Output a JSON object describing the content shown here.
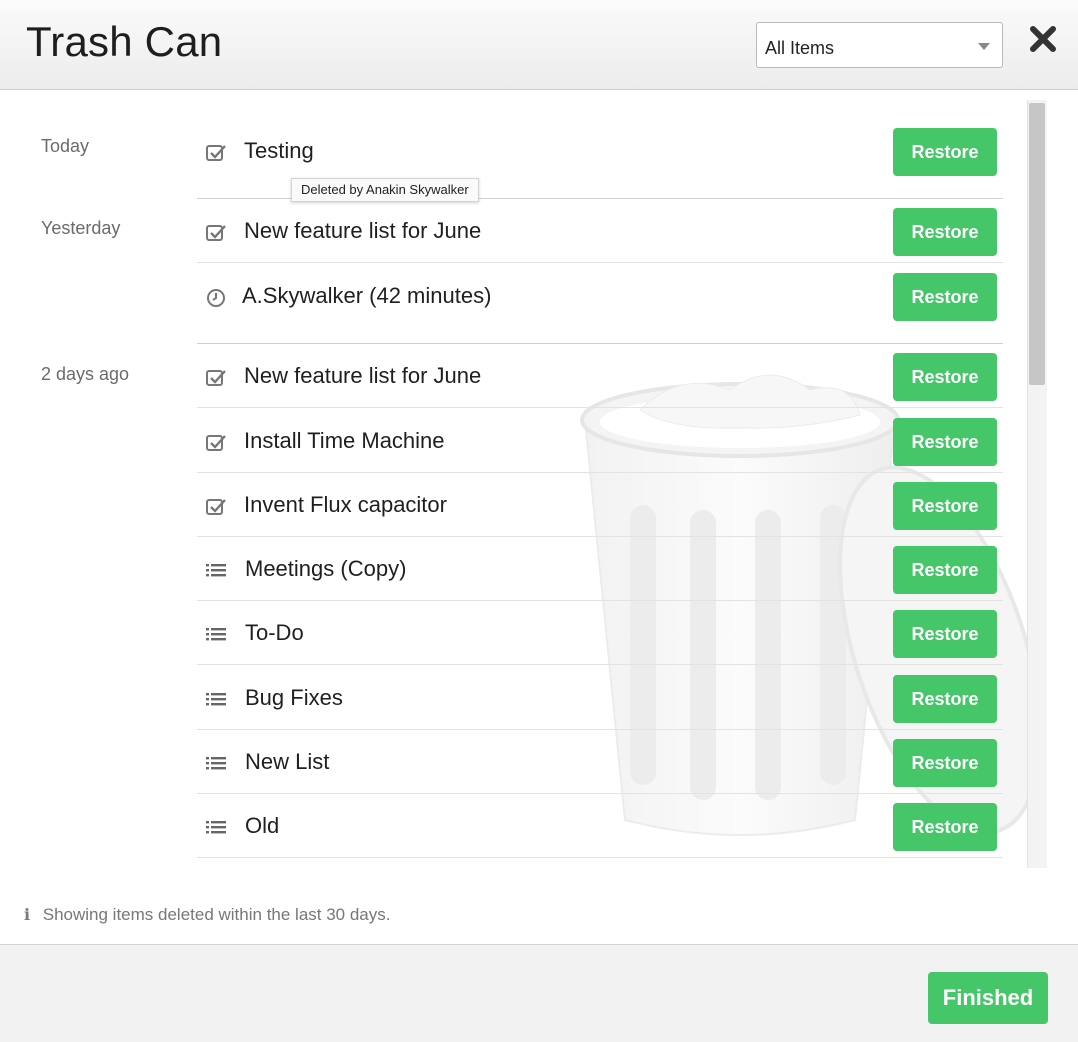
{
  "header": {
    "title": "Trash Can",
    "filter": {
      "selected": "All Items"
    },
    "close_icon": "close-icon"
  },
  "tooltip": "Deleted by Anakin Skywalker",
  "groups": [
    {
      "label": "Today"
    },
    {
      "label": "Yesterday"
    },
    {
      "label": "2 days ago"
    }
  ],
  "items": [
    {
      "label": "Testing",
      "icon": "checkbox-icon",
      "action": "Restore"
    },
    {
      "label": "New feature list for June",
      "icon": "checkbox-icon",
      "action": "Restore"
    },
    {
      "label": "A.Skywalker (42 minutes)",
      "icon": "clock-icon",
      "action": "Restore"
    },
    {
      "label": "New feature list for June",
      "icon": "checkbox-icon",
      "action": "Restore"
    },
    {
      "label": "Install Time Machine",
      "icon": "checkbox-icon",
      "action": "Restore"
    },
    {
      "label": "Invent Flux capacitor",
      "icon": "checkbox-icon",
      "action": "Restore"
    },
    {
      "label": "Meetings (Copy)",
      "icon": "list-icon",
      "action": "Restore"
    },
    {
      "label": "To-Do",
      "icon": "list-icon",
      "action": "Restore"
    },
    {
      "label": "Bug Fixes",
      "icon": "list-icon",
      "action": "Restore"
    },
    {
      "label": "New List",
      "icon": "list-icon",
      "action": "Restore"
    },
    {
      "label": "Old",
      "icon": "list-icon",
      "action": "Restore"
    }
  ],
  "info": {
    "icon": "info-icon",
    "text": "Showing items deleted within the last 30 days."
  },
  "footer": {
    "finished_label": "Finished"
  },
  "colors": {
    "accent": "#45c669",
    "header_bg": "#ececec",
    "footer_bg": "#f2f2f2"
  }
}
